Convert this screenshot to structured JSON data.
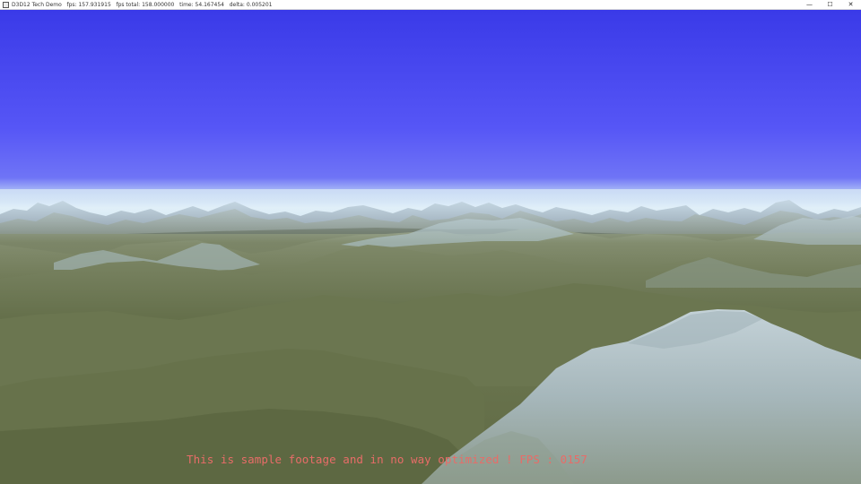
{
  "window": {
    "title": "D3D12 Tech Demo",
    "stats": "fps: 157.931915   fps total: 158.000000   time: 54.167454   delta: 0.005201",
    "controls": {
      "minimize": "—",
      "maximize": "☐",
      "close": "✕"
    }
  },
  "scene": {
    "sky_color": "#5050f2",
    "horizon_haze_color": "#dceefa",
    "terrain_color": "#6f7a52",
    "snow_color": "#b3c6cc"
  },
  "overlay": {
    "message": "This is sample footage and in no way optimized ! FPS : 0157",
    "color": "#e86c68"
  }
}
